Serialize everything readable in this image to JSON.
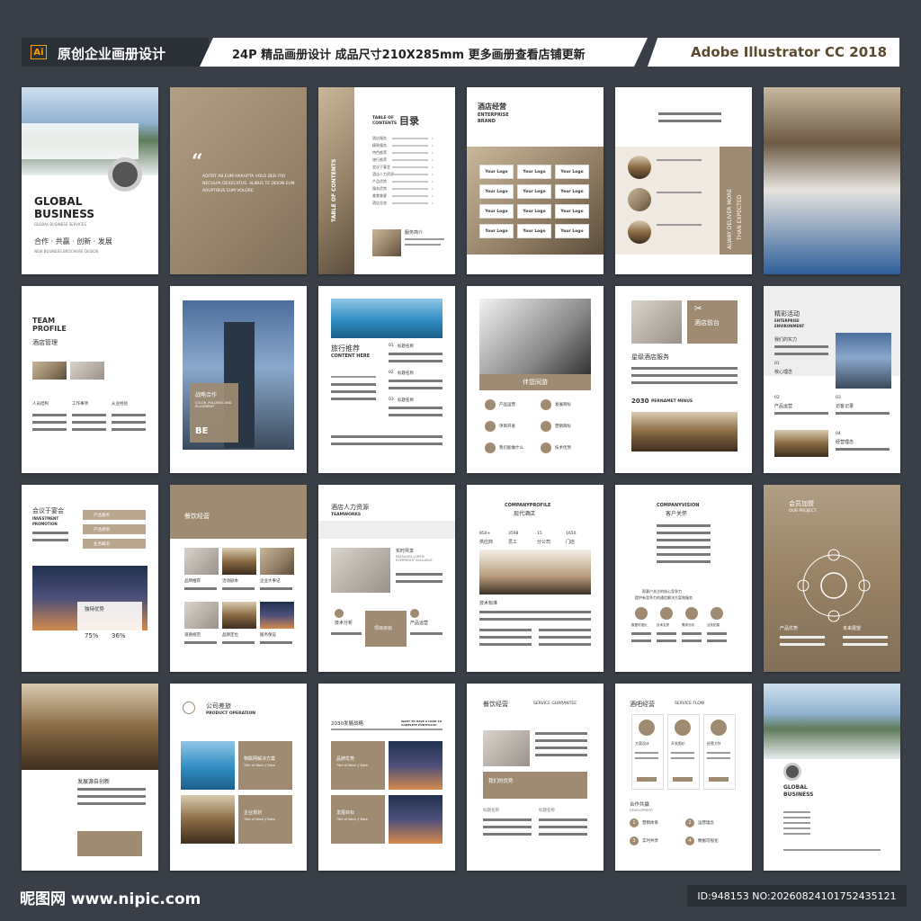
{
  "banner": {
    "ai_label": "Ai",
    "title": "原创企业画册设计",
    "spec": "24P 精品画册设计  成品尺寸210X285mm  更多画册查看店铺更新",
    "software": "Adobe Illustrator CC 2018"
  },
  "pages": {
    "cover": {
      "title1": "GLOBAL",
      "title2": "BUSINESS",
      "sub": "GLOBAL BUSINESS SERVICES",
      "slogan": "合作 · 共赢 · 创新 · 发展",
      "sub2": "NEW BUSINESS   BROCHURE DESIGN"
    },
    "quote": {
      "mark": "“",
      "text": "ADITAT AB EUM HARUPTA VOLO DEB ITIO NECULPA DEXECATUS. ALIBUS TE DEION EUM ARUPTIBUS EUM VOLORE"
    },
    "toc": {
      "vertical": "TABLE OF CONTENTS",
      "title_en1": "TABLE OF",
      "title_en2": "CONTENTS",
      "title": "目录",
      "items": [
        "酒店服务",
        "精致服务",
        "特色推荐",
        "旅行推荐",
        "会议于宴会",
        "酒店人力资源",
        "产品优势",
        "服务优势",
        "美食美客",
        "酒店业态"
      ],
      "foot": "服务简介"
    },
    "brand": {
      "title": "酒店经营",
      "en1": "ENTERPRISE",
      "en2": "BRAND",
      "logos": [
        "Your Logo",
        "Your Logo",
        "Your Logo",
        "Your Logo",
        "Your Logo",
        "Your Logo",
        "Your Logo",
        "Your Logo",
        "Your Logo",
        "Your Logo",
        "Your Logo",
        "Your Logo"
      ]
    },
    "deliver": {
      "vertical1": "ALWAY DELIVER MORE",
      "vertical2": "THAN EXPECTED"
    },
    "team": {
      "en1": "TEAM",
      "en2": "PROFILE",
      "title": "酒店管理",
      "cols": [
        "人员结构",
        "工作事项",
        "从业经验"
      ]
    },
    "tower": {
      "title": "战略合作",
      "sub": "COLOR, PULLINGS AND PLACEMENT",
      "tag": "BE"
    },
    "travel": {
      "title": "旅行推荐",
      "en": "CONTENT HERE",
      "n1": "01",
      "n2": "02",
      "n3": "03",
      "lab": "标题名称"
    },
    "drive": {
      "title": "伴您同游",
      "items": [
        "产品运营",
        "发展目标",
        "项目开发",
        "营销目标",
        "我们能做什么",
        "技术优势"
      ]
    },
    "star": {
      "tag": "酒店前台",
      "title": "星级酒店服务",
      "year": "2030",
      "year_en": "PERNAMET MINUS"
    },
    "activity": {
      "title": "精彩活动",
      "en1": "ENTERPRISE",
      "en2": "ENVIRONMENT",
      "s1": "我们的实力",
      "n1": "01",
      "s2": "核心理念",
      "n2": "02",
      "s3": "产品运营",
      "n3": "03",
      "s4": "访客记录",
      "n4": "04",
      "s5": "经营理念"
    },
    "meeting": {
      "title": "会议于宴会",
      "en1": "INVESTMENT",
      "en2": "PROMOTION",
      "tabs": [
        "产品服务",
        "产品规划",
        "业务概况"
      ],
      "box": "独特优势",
      "p1": "75%",
      "p2": "36%"
    },
    "catering": {
      "title": "餐饮经营",
      "labels": [
        "品牌推荐",
        "活动剧本",
        "企业大事记",
        "道德规范",
        "品牌定位",
        "服务保证"
      ]
    },
    "hr": {
      "title": "酒店人力资源",
      "en": "TEAMWORKS",
      "side": "实时共享",
      "side_en": "PASSAGES LOREM EVERYBODY AVAILABLE",
      "f1": "技术分析",
      "f2": "项目目标",
      "f3": "产品运营"
    },
    "modern": {
      "en": "COMPANYPROFILE",
      "title": "现代酒店",
      "stats": [
        {
          "v": "850+",
          "l": "供应商"
        },
        {
          "v": "3598",
          "l": "员工"
        },
        {
          "v": "15",
          "l": "分公司"
        },
        {
          "v": "1650",
          "l": "门店"
        }
      ],
      "tag": "技术标准"
    },
    "vision": {
      "en": "COMPANYVISION",
      "title": "客户关怀",
      "line1": "帮客户关注的核心竞争力",
      "line2": "提供有竞争力的通信解决方案和服务",
      "icons": [
        "数据可视化",
        "技术支撑",
        "需求分析",
        "业务拓展"
      ]
    },
    "member": {
      "title": "会员加盟",
      "en": "OUR PROJECT",
      "l1": "产品优势",
      "l2": "未来展望"
    },
    "lobby": {
      "title": "发展源自创新"
    },
    "operation": {
      "title": "公司差旅",
      "en": "PRODUCT OPERATION",
      "b1": "物联网解决方案",
      "b1s": "Title of Work // Date",
      "b2": "企业规划",
      "b2s": "Title of Work // Date"
    },
    "strategy": {
      "title": "2030发展战略",
      "en": "WANT TO HAVE A LOOK TO COMPLETE PORTFOLIO?",
      "b1": "品牌优势",
      "b1s": "Title of Work // Date",
      "b2": "发展目标",
      "b2s": "Title of Work // Date"
    },
    "service": {
      "title": "餐饮经营",
      "en": "SERVICE GUARANTEE",
      "bar": "我们的优势",
      "a": "标题名称",
      "b": "标题名称"
    },
    "bar": {
      "title": "酒吧经营",
      "en": "SERVICE FLOW",
      "c": [
        "方案设计",
        "开发报价",
        "经营方针"
      ],
      "sub": "合作共赢",
      "sub_en": "DEVELOPMENT",
      "items": [
        "营销体系",
        "运营理念",
        "实时共享",
        "数据可视化"
      ],
      "nums": [
        "1",
        "2",
        "3",
        "4"
      ]
    },
    "back": {
      "title1": "GLOBAL",
      "title2": "BUSINESS"
    }
  },
  "footer": {
    "logo": "昵图网 www.nipic.com",
    "id": "ID:948153 NO:20260824101752435121"
  },
  "colors": {
    "accent": "#9e8b72",
    "bg": "#3a3f47",
    "banner_dark": "#2b2f36",
    "ai_orange": "#f7a000"
  }
}
